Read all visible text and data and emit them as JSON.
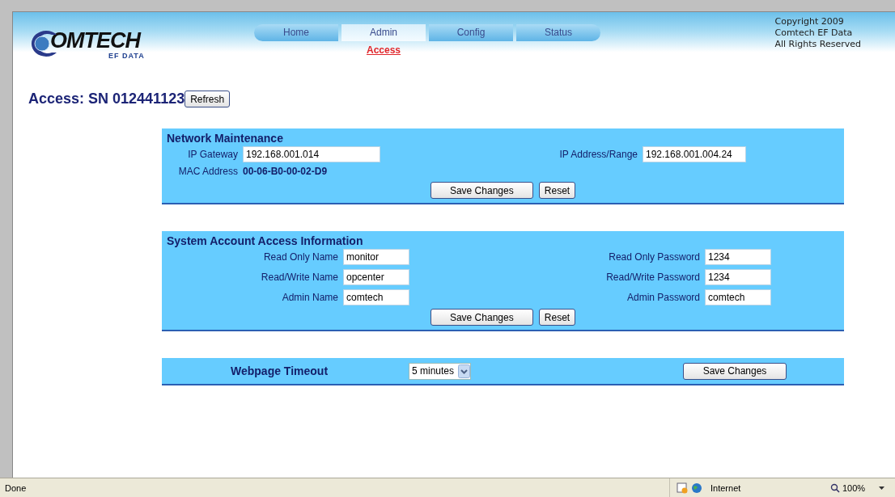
{
  "logo": {
    "mark": "OMTECH",
    "sub": "EF DATA"
  },
  "nav": [
    {
      "label": "Home",
      "selected": false
    },
    {
      "label": "Admin",
      "selected": true
    },
    {
      "label": "Config",
      "selected": false
    },
    {
      "label": "Status",
      "selected": false
    }
  ],
  "subnav": [
    {
      "label": "Access",
      "selected": true
    }
  ],
  "copyright": [
    "Copyright 2009",
    "Comtech EF Data",
    "All Rights Reserved"
  ],
  "page_title": "Access: SN 012441123",
  "refresh_button": "Refresh",
  "sections": [
    {
      "title": "Network Maintenance",
      "rows": [
        {
          "left": {
            "kind": "input",
            "label": "IP Gateway",
            "value": "192.168.001.014"
          },
          "right": {
            "kind": "input",
            "label": "IP Address/Range",
            "value": "192.168.001.004.24"
          }
        },
        {
          "left": {
            "kind": "static",
            "label": "MAC Address",
            "value": "00-06-B0-00-02-D9"
          }
        }
      ],
      "buttons": [
        "Save Changes",
        "Reset"
      ]
    },
    {
      "title": "System Account Access Information",
      "rows": [
        {
          "left": {
            "kind": "input",
            "label": "Read Only Name",
            "value": "monitor"
          },
          "right": {
            "kind": "input",
            "label": "Read Only Password",
            "value": "1234"
          }
        },
        {
          "left": {
            "kind": "input",
            "label": "Read/Write Name",
            "value": "opcenter"
          },
          "right": {
            "kind": "input",
            "label": "Read/Write Password",
            "value": "1234"
          }
        },
        {
          "left": {
            "kind": "input",
            "label": "Admin Name",
            "value": "comtech"
          },
          "right": {
            "kind": "input",
            "label": "Admin Password",
            "value": "comtech"
          }
        }
      ],
      "buttons": [
        "Save Changes",
        "Reset"
      ]
    }
  ],
  "timeout": {
    "label": "Webpage Timeout",
    "value": "5 minutes",
    "button": "Save Changes"
  },
  "status_bar": {
    "text": "Done",
    "zone": "Internet",
    "zoom": "100%"
  }
}
